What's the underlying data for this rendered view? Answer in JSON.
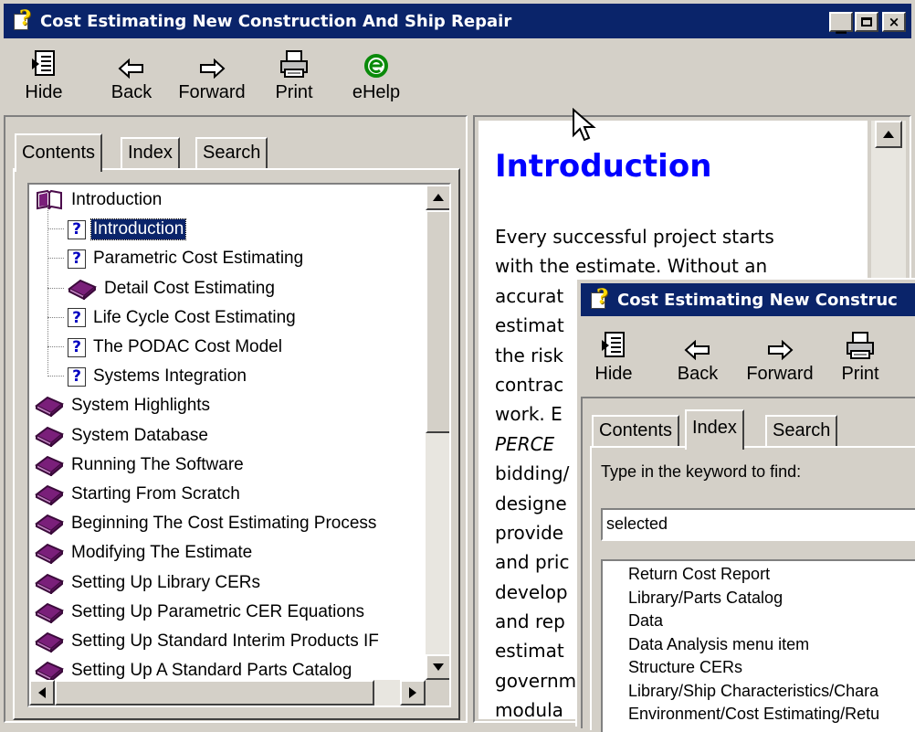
{
  "main_window": {
    "title": "Cost Estimating New Construction And Ship Repair",
    "title_controls": {
      "minimize": "_",
      "maximize": "□",
      "close": "×"
    },
    "toolbar": [
      {
        "label": "Hide",
        "icon": "hide-icon"
      },
      {
        "label": "Back",
        "icon": "back-arrow-icon"
      },
      {
        "label": "Forward",
        "icon": "forward-arrow-icon"
      },
      {
        "label": "Print",
        "icon": "printer-icon"
      },
      {
        "label": "eHelp",
        "icon": "ehelp-icon"
      }
    ],
    "tabs": [
      {
        "label": "Contents",
        "active": true
      },
      {
        "label": "Index",
        "active": false
      },
      {
        "label": "Search",
        "active": false
      }
    ],
    "tree": [
      {
        "label": "Introduction",
        "icon": "open-book-icon",
        "level": 0
      },
      {
        "label": "Introduction",
        "icon": "help-topic-icon",
        "level": 1,
        "selected": true
      },
      {
        "label": "Parametric Cost Estimating",
        "icon": "help-topic-icon",
        "level": 1
      },
      {
        "label": "Detail Cost Estimating",
        "icon": "closed-book-icon",
        "level": 1
      },
      {
        "label": "Life Cycle Cost Estimating",
        "icon": "help-topic-icon",
        "level": 1
      },
      {
        "label": "The PODAC Cost Model",
        "icon": "help-topic-icon",
        "level": 1
      },
      {
        "label": "Systems Integration",
        "icon": "help-topic-icon",
        "level": 1
      },
      {
        "label": "System Highlights",
        "icon": "closed-book-icon",
        "level": 0
      },
      {
        "label": "System Database",
        "icon": "closed-book-icon",
        "level": 0
      },
      {
        "label": "Running The Software",
        "icon": "closed-book-icon",
        "level": 0
      },
      {
        "label": "Starting From Scratch",
        "icon": "closed-book-icon",
        "level": 0
      },
      {
        "label": "Beginning The Cost Estimating Process",
        "icon": "closed-book-icon",
        "level": 0
      },
      {
        "label": "Modifying The Estimate",
        "icon": "closed-book-icon",
        "level": 0
      },
      {
        "label": "Setting Up Library CERs",
        "icon": "closed-book-icon",
        "level": 0
      },
      {
        "label": "Setting Up Parametric CER Equations",
        "icon": "closed-book-icon",
        "level": 0
      },
      {
        "label": "Setting Up Standard Interim Products IF",
        "icon": "closed-book-icon",
        "level": 0
      },
      {
        "label": "Setting Up A Standard Parts Catalog",
        "icon": "closed-book-icon",
        "level": 0
      }
    ],
    "topic": {
      "heading": "Introduction",
      "lines": [
        "Every successful project starts",
        "with the estimate.  Without an",
        "accurat",
        "estimat",
        "the risk",
        "contrac",
        "work.  E",
        "PERCE",
        "bidding/",
        "designe",
        "provide",
        "and pric",
        "develop",
        "and rep",
        "estimat",
        "governm",
        "modula"
      ]
    }
  },
  "second_window": {
    "title": "Cost Estimating New Construc",
    "toolbar": [
      {
        "label": "Hide",
        "icon": "hide-icon"
      },
      {
        "label": "Back",
        "icon": "back-arrow-icon"
      },
      {
        "label": "Forward",
        "icon": "forward-arrow-icon"
      },
      {
        "label": "Print",
        "icon": "printer-icon"
      }
    ],
    "tabs": [
      {
        "label": "Contents",
        "active": false
      },
      {
        "label": "Index",
        "active": true
      },
      {
        "label": "Search",
        "active": false
      }
    ],
    "keyword_prompt": "Type in the keyword to find:",
    "keyword_value": "selected",
    "index_items": [
      "Return Cost Report",
      "Library/Parts Catalog",
      "Data",
      "Data Analysis menu item",
      "Structure CERs",
      "Library/Ship Characteristics/Chara",
      "Environment/Cost Estimating/Retu"
    ]
  }
}
